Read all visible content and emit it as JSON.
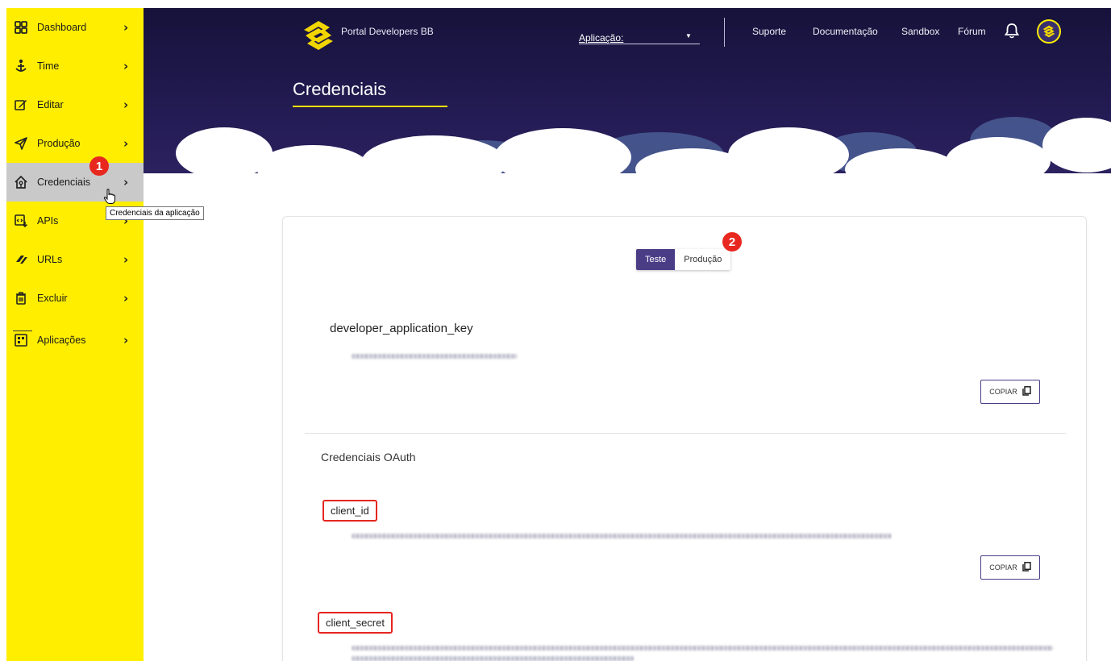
{
  "sidebar": {
    "items": [
      {
        "label": "Dashboard"
      },
      {
        "label": "Time"
      },
      {
        "label": "Editar"
      },
      {
        "label": "Produção"
      },
      {
        "label": "Credenciais"
      },
      {
        "label": "APIs"
      },
      {
        "label": "URLs"
      },
      {
        "label": "Excluir"
      },
      {
        "label": "Aplicações"
      }
    ],
    "tooltip": "Credenciais da aplicação"
  },
  "badges": {
    "one": "1",
    "two": "2"
  },
  "header": {
    "portal_title": "Portal Developers BB",
    "app_label": "Aplicação:",
    "nav": [
      "Suporte",
      "Documentação",
      "Sandbox",
      "Fórum"
    ],
    "page_title": "Credenciais"
  },
  "card": {
    "env_toggle": {
      "test": "Teste",
      "production": "Produção",
      "selected": "Teste"
    },
    "dev_key_label": "developer_application_key",
    "copy_label": "COPIAR",
    "oauth_title": "Credenciais OAuth",
    "client_id_label": "client_id",
    "client_secret_label": "client_secret"
  },
  "colors": {
    "sidebar_bg": "#ffee00",
    "header_bg": "#1d1848",
    "accent": "#4b3c86",
    "highlight": "#e52520",
    "brand_yellow": "#ffe000"
  }
}
